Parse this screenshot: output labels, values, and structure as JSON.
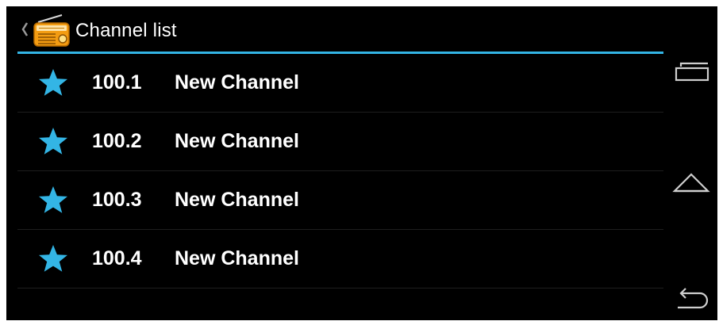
{
  "action_bar": {
    "title": "Channel list",
    "up_icon": "chevron-left-icon",
    "app_icon": "radio-icon"
  },
  "channels": [
    {
      "frequency": "100.1",
      "name": "New Channel",
      "icon": "star-icon"
    },
    {
      "frequency": "100.2",
      "name": "New Channel",
      "icon": "star-icon"
    },
    {
      "frequency": "100.3",
      "name": "New Channel",
      "icon": "star-icon"
    },
    {
      "frequency": "100.4",
      "name": "New Channel",
      "icon": "star-icon"
    }
  ],
  "nav_bar": {
    "recent_apps_icon": "recent-apps-icon",
    "home_icon": "home-icon",
    "back_icon": "back-icon"
  },
  "colors": {
    "accent": "#33b5e5",
    "background": "#000000",
    "text": "#ffffff",
    "divider": "#1e1e1e",
    "radio_body": "#f39c12"
  }
}
